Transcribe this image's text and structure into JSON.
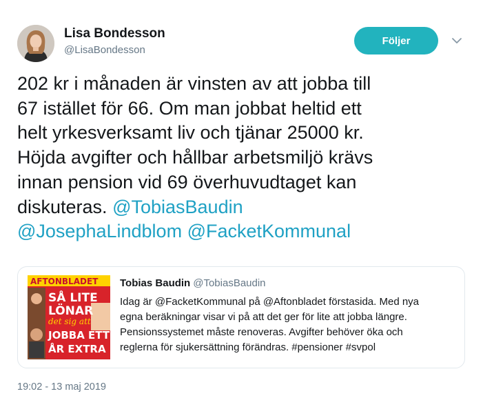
{
  "author": {
    "name": "Lisa Bondesson",
    "handle": "@LisaBondesson"
  },
  "follow_button": {
    "label": "Följer",
    "color": "#22b3be"
  },
  "menu": {
    "icon": "chevron-down-icon"
  },
  "tweet": {
    "lines": [
      "202 kr i månaden är vinsten av att jobba till",
      "67 istället för 66. Om man jobbat heltid ett",
      "helt yrkesverksamt liv och tjänar 25000 kr.",
      "Höjda avgifter och hållbar arbetsmiljö krävs",
      "innan pension vid 69 överhuvudtaget kan"
    ],
    "line6_text": "diskuteras.",
    "mentions": [
      "@TobiasBaudin",
      "@JosephaLindblom",
      "@FacketKommunal"
    ]
  },
  "quote": {
    "name": "Tobias Baudin",
    "handle": "@TobiasBaudin",
    "lines": [
      "Idag är @FacketKommunal på @Aftonbladet förstasida. Med nya",
      "egna beräkningar visar vi på att det ger för lite att jobba längre.",
      "Pensionssystemet måste renoveras. Avgifter behöver öka och",
      "reglerna för sjukersättning förändras. #pensioner #svpol"
    ],
    "thumbnail": {
      "masthead": "AFTONBLADET",
      "headline_lines": [
        "SÅ LITE",
        "LÖNAR",
        "det sig att",
        "JOBBA ETT",
        "ÅR EXTRA"
      ]
    }
  },
  "timestamp": "19:02 - 13 maj 2019",
  "colors": {
    "link": "#1fa1c4",
    "secondary_text": "#657786",
    "border": "#e1e8ed"
  }
}
